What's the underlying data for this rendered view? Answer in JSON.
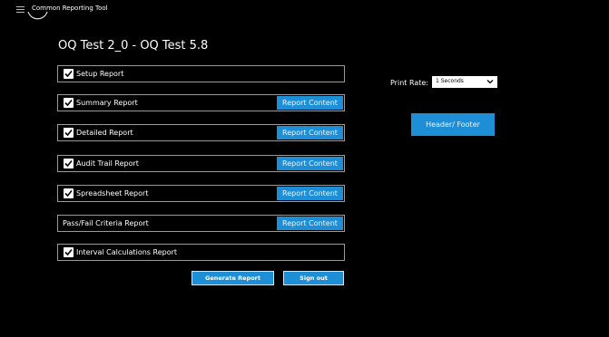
{
  "app": {
    "title": "Common Reporting Tool",
    "page_title": "OQ Test 2_0 - OQ Test 5.8"
  },
  "reports": [
    {
      "label": "Setup Report",
      "checked": true,
      "has_button": false
    },
    {
      "label": "Summary Report",
      "checked": true,
      "has_button": true
    },
    {
      "label": "Detailed Report",
      "checked": true,
      "has_button": true
    },
    {
      "label": "Audit Trail Report",
      "checked": true,
      "has_button": true
    },
    {
      "label": "Spreadsheet Report",
      "checked": true,
      "has_button": true
    },
    {
      "label": "Pass/Fail Criteria Report",
      "checked": false,
      "has_button": true
    },
    {
      "label": "Interval Calculations Report",
      "checked": true,
      "has_button": false
    }
  ],
  "report_content_label": "Report Content",
  "print_rate": {
    "label": "Print Rate:",
    "value": "1 Seconds"
  },
  "header_footer_label": "Header/ Footer",
  "generate_label": "Generate Report",
  "signout_label": "Sign out",
  "colors": {
    "background": "#000000",
    "accent": "#1e8fd6",
    "text": "#ffffff",
    "border": "#9a9a9a"
  }
}
